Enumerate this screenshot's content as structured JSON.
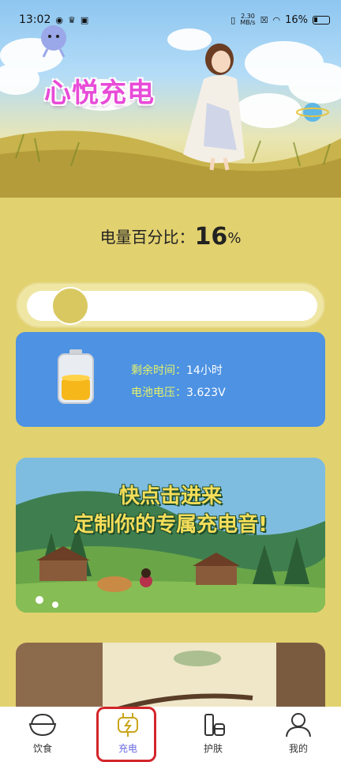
{
  "status_bar": {
    "time": "13:02",
    "net_speed_value": "2.30",
    "net_speed_unit": "MB/s",
    "battery": "16%"
  },
  "hero": {
    "title": "心悦充电"
  },
  "battery": {
    "label": "电量百分比：",
    "percent": "16",
    "unit": "%",
    "level_fraction": 0.16
  },
  "info": {
    "time_label": "剩余时间：",
    "time_value": "14小时",
    "voltage_label": "电池电压：",
    "voltage_value": "3.623V"
  },
  "promo": {
    "line1": "快点击进来",
    "line2": "定制你的专属充电音!"
  },
  "nav": {
    "items": [
      {
        "label": "饮食",
        "icon": "rice-bowl-icon"
      },
      {
        "label": "充电",
        "icon": "charging-plug-icon",
        "active": true
      },
      {
        "label": "护肤",
        "icon": "skincare-bottle-icon"
      },
      {
        "label": "我的",
        "icon": "profile-icon"
      }
    ]
  },
  "colors": {
    "background": "#e2d16f",
    "card_blue": "#4d92e3",
    "title_pink": "#e84bd8",
    "active_tab": "#6a6ae0",
    "highlight_red": "#d3262a"
  }
}
